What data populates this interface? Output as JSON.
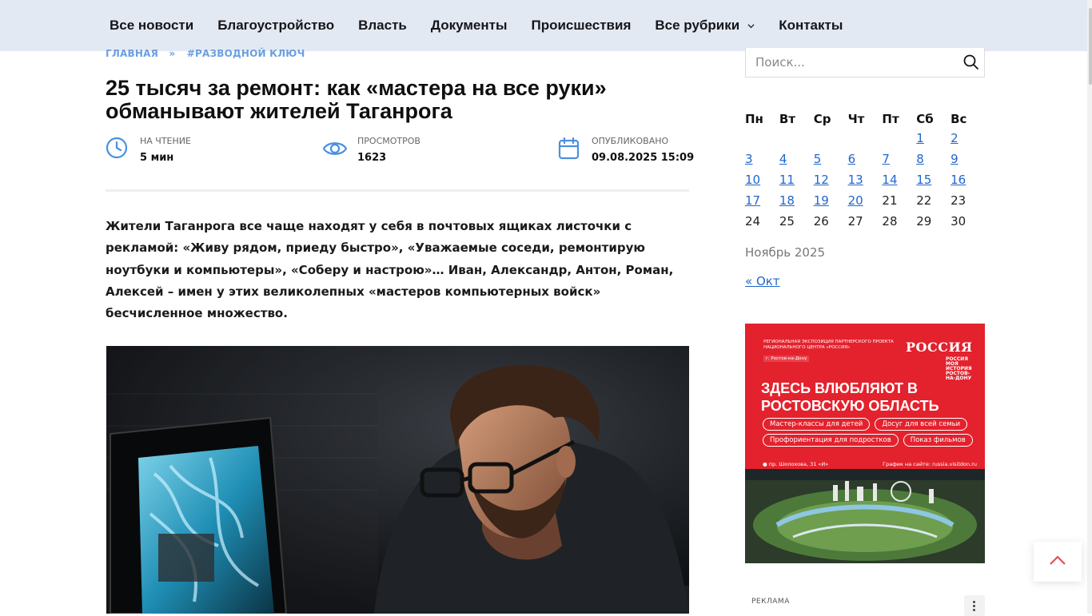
{
  "nav": {
    "items": [
      {
        "label": "Все новости"
      },
      {
        "label": "Благоустройство"
      },
      {
        "label": "Власть"
      },
      {
        "label": "Документы"
      },
      {
        "label": "Происшествия"
      },
      {
        "label": "Все рубрики",
        "has_dropdown": true
      },
      {
        "label": "Контакты"
      }
    ]
  },
  "breadcrumb": {
    "home": "ГЛАВНАЯ",
    "separator": "»",
    "tag": "#РАЗВОДНОЙ КЛЮЧ"
  },
  "article": {
    "title": "25 тысяч за ремонт: как «мастера на все руки» обманывают жителей Таганрога",
    "meta": {
      "read_label": "НА ЧТЕНИЕ",
      "read_value": "5 мин",
      "views_label": "ПРОСМОТРОВ",
      "views_value": "1623",
      "published_label": "ОПУБЛИКОВАНО",
      "published_value": "09.08.2025 15:09"
    },
    "lead": "Жители Таганрога все чаще находят у себя в почтовых ящиках листочки с рекламой: «Живу рядом, приеду быстро», «Уважаемые соседи, ремонтирую ноутбуки и компьютеры», «Соберу и настрою»… Иван, Александр, Антон, Роман, Алексей – имен у этих великолепных «мастеров компьютерных войск» бесчисленное множество."
  },
  "sidebar": {
    "search_placeholder": "Поиск...",
    "calendar": {
      "weekdays": [
        "Пн",
        "Вт",
        "Ср",
        "Чт",
        "Пт",
        "Сб",
        "Вс"
      ],
      "weeks": [
        [
          "",
          "",
          "",
          "",
          "",
          "1",
          "2"
        ],
        [
          "3",
          "4",
          "5",
          "6",
          "7",
          "8",
          "9"
        ],
        [
          "10",
          "11",
          "12",
          "13",
          "14",
          "15",
          "16"
        ],
        [
          "17",
          "18",
          "19",
          "20",
          "21",
          "22",
          "23"
        ],
        [
          "24",
          "25",
          "26",
          "27",
          "28",
          "29",
          "30"
        ]
      ],
      "linked_through": 20,
      "caption": "Ноябрь 2025",
      "prev_link": "« Окт"
    },
    "banner": {
      "small_text": "Региональная экспозиция партнерского проекта Национального центра «Россия»",
      "city": "г. Ростов-на-Дону",
      "brand": "РОССИЯ",
      "brand_sub": "РОССИЯ МОЯ ИСТОРИЯ РОСТОВ-НА-ДОНУ",
      "headline": "Здесь влюбляют в Ростовскую область",
      "pills": [
        "Мастер-классы для детей",
        "Досуг для всей семьи",
        "Профориентация для подростков",
        "Показ фильмов"
      ],
      "address": "пр. Шолохова, 31 «И»",
      "schedule": "График на сайте: russia.visitdon.ru"
    },
    "ad_label": "РЕКЛАМА"
  },
  "colors": {
    "nav_bg": "#e3e9f3",
    "accent_blue": "#4a90e2",
    "link_blue": "#2266cc",
    "banner_red": "#e3222d"
  },
  "icons": {
    "read": "clock-icon",
    "views": "eye-icon",
    "published": "calendar-icon",
    "search": "search-icon",
    "dropdown": "chevron-down-icon",
    "to_top": "chevron-up-icon"
  }
}
